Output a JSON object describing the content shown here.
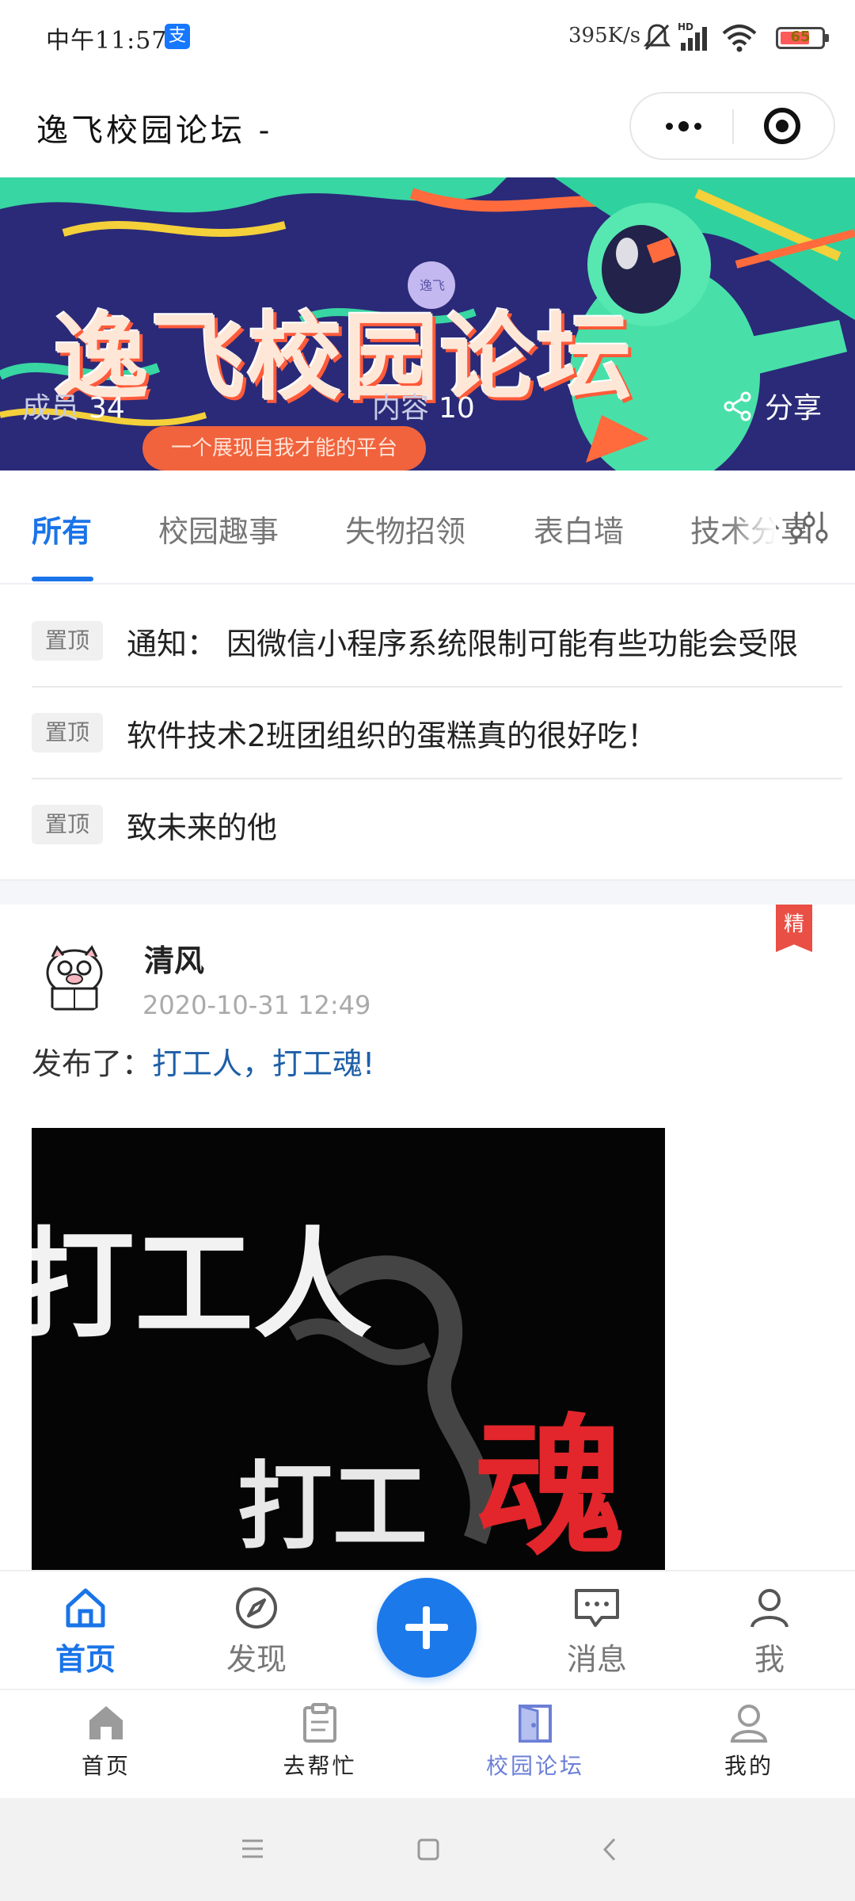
{
  "status_bar": {
    "time": "中午11:57",
    "app_badge": "支",
    "net_speed": "395K/s",
    "battery": "65"
  },
  "titlebar": {
    "title": "逸飞校园论坛 -"
  },
  "banner": {
    "title": "逸飞校园论坛",
    "members_label": "成员",
    "members_count": "34",
    "content_label": "内容",
    "content_count": "10",
    "share_label": "分享",
    "slogan": "一个展现自我才能的平台"
  },
  "tabs": {
    "items": [
      "所有",
      "校园趣事",
      "失物招领",
      "表白墙",
      "技术分享"
    ]
  },
  "pinned": {
    "tag": "置顶",
    "items": [
      "通知： 因微信小程序系统限制可能有些功能会受限",
      "软件技术2班团组织的蛋糕真的很好吃！",
      "致未来的他"
    ]
  },
  "post": {
    "badge": "精",
    "author": "清风",
    "time": "2020-10-31 12:49",
    "prefix": "发布了：",
    "link": "打工人，打工魂!",
    "image_text_1": "打工人",
    "image_text_2": "打工",
    "image_text_3": "魂"
  },
  "community_nav": {
    "home": "首页",
    "discover": "发现",
    "messages": "消息",
    "me": "我"
  },
  "tabbar": {
    "home": "首页",
    "help": "去帮忙",
    "forum": "校园论坛",
    "mine": "我的"
  },
  "colors": {
    "accent": "#1a74e8",
    "banner_bg": "#2a2a78",
    "featured": "#e94f45"
  }
}
